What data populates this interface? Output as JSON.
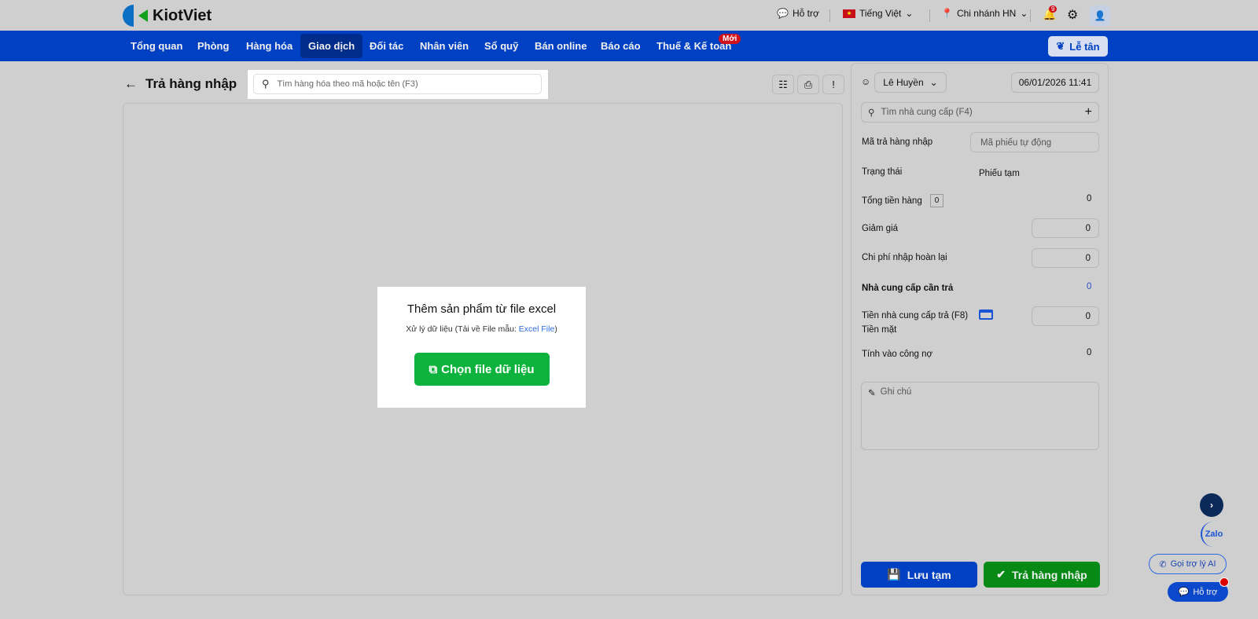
{
  "brand": "KiotViet",
  "topbar": {
    "support": "Hỗ trợ",
    "language": "Tiếng Việt",
    "branch": "Chi nhánh HN",
    "notifications": "9"
  },
  "nav": {
    "items": [
      "Tổng quan",
      "Phòng",
      "Hàng hóa",
      "Giao dịch",
      "Đối tác",
      "Nhân viên",
      "Sổ quỹ",
      "Bán online",
      "Báo cáo",
      "Thuế & Kế toán"
    ],
    "new_badge": "Mới",
    "reception": "Lễ tân"
  },
  "page": {
    "title": "Trả hàng nhập",
    "search_placeholder": "Tìm hàng hóa theo mã hoặc tên (F3)"
  },
  "modal": {
    "title": "Thêm sản phẩm từ file excel",
    "desc": "Xử lý dữ liệu (Tải về File mẫu: ",
    "link": "Excel File",
    "desc_end": ")",
    "button": "Chọn file dữ liệu"
  },
  "side": {
    "user": "Lê Huyền",
    "datetime": "06/01/2026 11:41",
    "supplier_placeholder": "Tìm nhà cung cấp (F4)",
    "code_label": "Mã trả hàng nhập",
    "code_placeholder": "Mã phiếu tự động",
    "status_label": "Trạng thái",
    "status": "Phiếu tạm",
    "total_label": "Tổng tiền hàng",
    "total_count": "0",
    "total": "0",
    "discount_label": "Giảm giá",
    "discount": "0",
    "refund_cost_label": "Chi phí nhập hoàn lại",
    "refund_cost": "0",
    "supplier_due_label": "Nhà cung cấp cần trả",
    "supplier_due": "0",
    "supplier_paid_label": "Tiền nhà cung cấp trả (F8)",
    "payment_method": "Tiền mặt",
    "supplier_paid": "0",
    "debt_label": "Tính vào công nợ",
    "debt": "0",
    "note_placeholder": "Ghi chú",
    "save": "Lưu tạm",
    "submit": "Trả hàng nhập"
  },
  "widgets": {
    "zalo": "Zalo",
    "ai": "Gọi trợ lý AI",
    "help": "Hỗ trợ"
  },
  "colors": {
    "nav": "#0041c4",
    "green": "#0db33c",
    "save": "#0041c4",
    "submit": "#068a15"
  }
}
